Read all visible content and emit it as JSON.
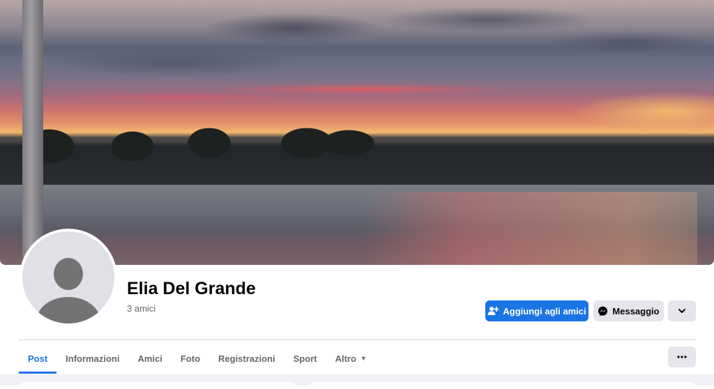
{
  "profile": {
    "name": "Elia Del Grande",
    "friends_count": "3 amici"
  },
  "actions": {
    "add_friend": {
      "label": "Aggiungi agli amici",
      "icon": "add-friend-icon"
    },
    "message": {
      "label": "Messaggio",
      "icon": "messenger-icon"
    },
    "more": {
      "icon": "chevron-down-icon"
    }
  },
  "tabs": [
    {
      "label": "Post",
      "active": true
    },
    {
      "label": "Informazioni",
      "active": false
    },
    {
      "label": "Amici",
      "active": false
    },
    {
      "label": "Foto",
      "active": false
    },
    {
      "label": "Registrazioni",
      "active": false
    },
    {
      "label": "Sport",
      "active": false
    },
    {
      "label": "Altro",
      "active": false,
      "has_dropdown": true
    }
  ],
  "tab_options_icon": "more-horizontal-icon",
  "colors": {
    "accent": "#1b74e4",
    "secondary_button": "#e4e6eb",
    "muted_text": "#65676b",
    "page_background": "#f0f2f5"
  }
}
